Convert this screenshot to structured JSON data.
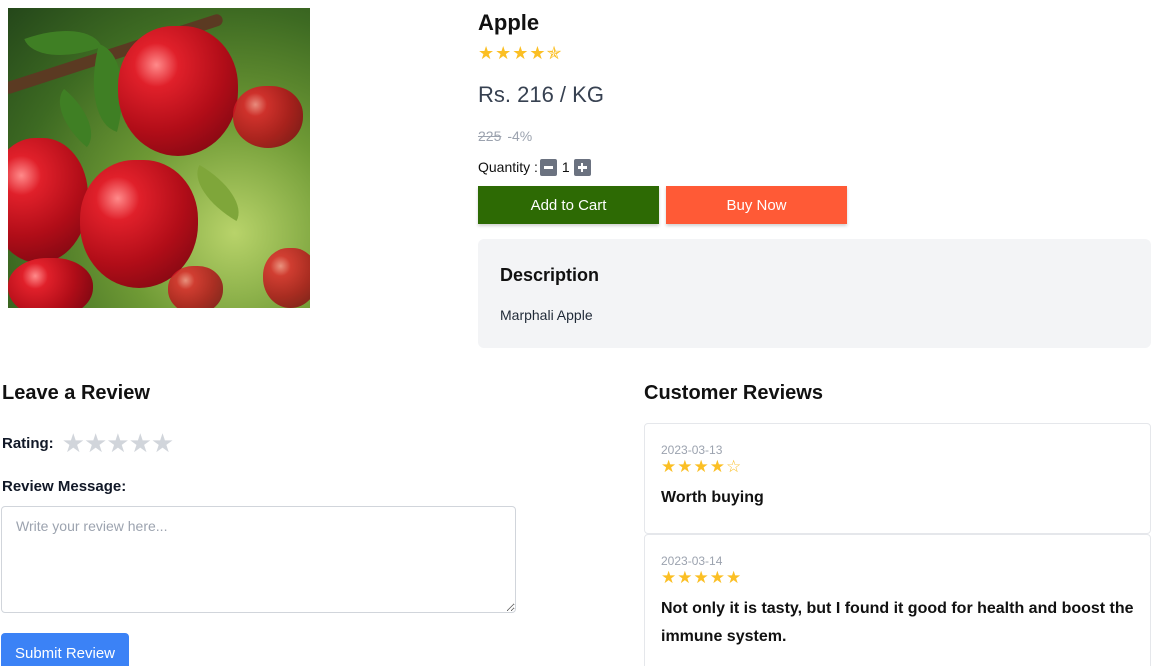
{
  "product": {
    "title": "Apple",
    "rating_stars": "★★★★✯",
    "price": "Rs. 216 / KG",
    "old_price": "225",
    "discount": "-4%",
    "quantity_label": "Quantity :",
    "quantity": "1",
    "add_to_cart_label": "Add to Cart",
    "buy_now_label": "Buy Now",
    "image_icon": "apple-photo"
  },
  "description": {
    "title": "Description",
    "text": "Marphali Apple"
  },
  "leave_review": {
    "heading": "Leave a Review",
    "rating_label": "Rating:",
    "rating_stars": "★★★★★",
    "message_label": "Review Message:",
    "placeholder": "Write your review here...",
    "submit_label": "Submit Review"
  },
  "customer_reviews": {
    "heading": "Customer Reviews",
    "items": [
      {
        "date": "2023-03-13",
        "stars": "★★★★☆",
        "text": "Worth buying"
      },
      {
        "date": "2023-03-14",
        "stars": "★★★★★",
        "text": "Not only it is tasty, but I found it good for health and boost the immune system."
      }
    ]
  },
  "colors": {
    "star": "#fbbf24",
    "add_to_cart": "#2d6a04",
    "buy_now": "#ff5a36",
    "submit": "#3b82f6"
  }
}
